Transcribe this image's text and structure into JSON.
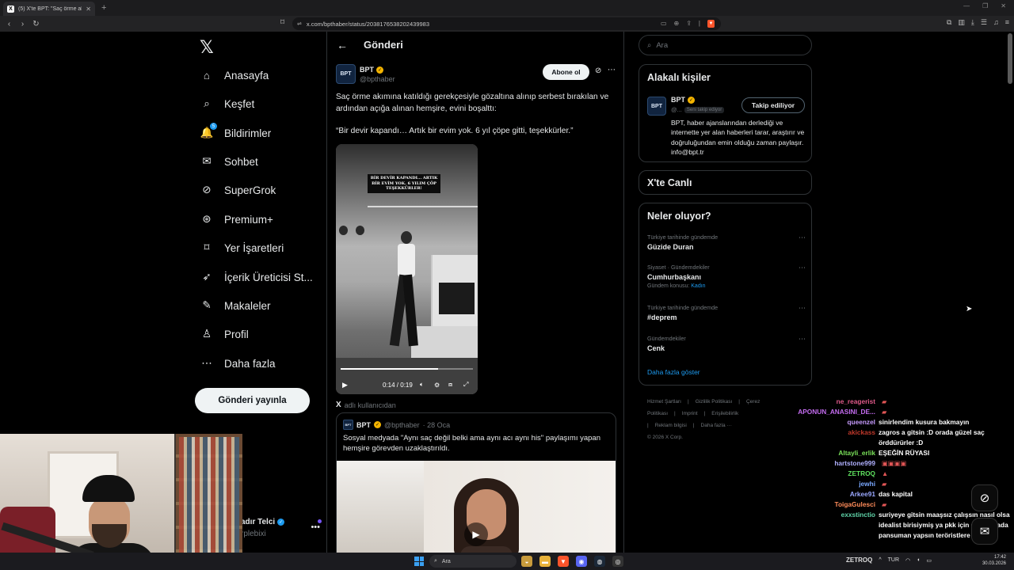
{
  "browser": {
    "tab_title": "(5) X'te BPT: \"Saç örme akımına ...",
    "tab_favicon": "X",
    "url": "x.com/bpthaber/status/2038176538202439983",
    "accent": "#1d9bf0"
  },
  "nav": {
    "logo": "𝕏",
    "items": [
      {
        "label": "Anasayfa",
        "icon": "home-icon",
        "glyph": "⌂"
      },
      {
        "label": "Keşfet",
        "icon": "search-icon",
        "glyph": "⌕"
      },
      {
        "label": "Bildirimler",
        "icon": "bell-icon",
        "glyph": "🔔",
        "badge": "5"
      },
      {
        "label": "Sohbet",
        "icon": "mail-icon",
        "glyph": "✉"
      },
      {
        "label": "SuperGrok",
        "icon": "grok-icon",
        "glyph": "⊘"
      },
      {
        "label": "Premium+",
        "icon": "premium-icon",
        "glyph": "⊛"
      },
      {
        "label": "Yer İşaretleri",
        "icon": "bookmark-icon",
        "glyph": "⌑"
      },
      {
        "label": "İçerik Üreticisi St...",
        "icon": "rocket-icon",
        "glyph": "➶"
      },
      {
        "label": "Makaleler",
        "icon": "article-icon",
        "glyph": "✎"
      },
      {
        "label": "Profil",
        "icon": "profile-icon",
        "glyph": "♙"
      },
      {
        "label": "Daha fazla",
        "icon": "more-circle-icon",
        "glyph": "⋯"
      }
    ],
    "post_button": "Gönderi yayınla",
    "account": {
      "name": "adır Telci",
      "handle": "rplebixi"
    }
  },
  "main": {
    "back": "←",
    "title": "Gönderi",
    "tweet": {
      "avatar_text": "BPT",
      "name": "BPT",
      "handle": "@bpthaber",
      "subscribe": "Abone ol",
      "text": "Saç örme akımına katıldığı gerekçesiyle gözaltına alınıp serbest bırakılan ve ardından açığa alınan hemşire, evini boşalttı:",
      "quote": "“Bir devir kapandı… Artık bir evim yok. 6 yıl çöpe gitti, teşekkürler.”",
      "video": {
        "caption": "BİR DEVİR KAPANDI... ARTIK BİR EVİM YOK. 6 YILIM ÇÖP TEŞEKKÜRLER!",
        "time": "0:14 / 0:19",
        "progress": 0.737
      },
      "source_prefix": "X",
      "source": "adlı kullanıcıdan"
    },
    "quoted": {
      "avatar_text": "BPT",
      "name": "BPT",
      "handle": "@bpthaber",
      "date": "· 28 Oca",
      "text": "Sosyal medyada \"Aynı saç değil belki ama aynı acı aynı his\" paylaşımı yapan hemşire görevden uzaklaştırıldı."
    }
  },
  "right": {
    "search_placeholder": "Ara",
    "related": {
      "title": "Alakalı kişiler",
      "name": "BPT",
      "handle": "@...",
      "follows_you": "Seni takip ediyor",
      "follow_btn": "Takip ediliyor",
      "bio": "BPT, haber ajanslarından derlediği ve internette yer alan haberleri tarar, araştırır ve doğruluğundan emin olduğu zaman paylaşır. info@bpt.tr"
    },
    "live": {
      "title": "X'te Canlı"
    },
    "trends": {
      "title": "Neler oluyor?",
      "items": [
        {
          "context": "Türkiye tarihinde gündemde",
          "name": "Güzide Duran",
          "sub": ""
        },
        {
          "context": "Siyaset · Gündemdekiler",
          "name": "Cumhurbaşkanı",
          "sub": "Gündem konusu:",
          "sub_link": "Kadın"
        },
        {
          "context": "Türkiye tarihinde gündemde",
          "name": "#deprem",
          "sub": ""
        },
        {
          "context": "Gündemdekiler",
          "name": "Cenk",
          "sub": ""
        }
      ],
      "show_more": "Daha fazla göster"
    },
    "footer": [
      "Hizmet Şartları",
      "|",
      "Gizlilik Politikası",
      "|",
      "Çerez Politikası",
      "|",
      "Imprint",
      "|",
      "Erişilebilirlik",
      "|",
      "Reklam bilgisi",
      "|",
      "Daha fazla ···",
      "© 2026 X Corp."
    ]
  },
  "chat": [
    {
      "user": "ne_reagerist",
      "color": "#e05a8a",
      "msg": "",
      "emote": "▰"
    },
    {
      "user": "APONUN_ANASINI_DE...",
      "color": "#c46cf0",
      "msg": "",
      "emote": "▰"
    },
    {
      "user": "queenzel",
      "color": "#c79cff",
      "msg": "sinirlendim kusura bakmayın"
    },
    {
      "user": "akickass",
      "color": "#c0392b",
      "msg": "zagros a gitsin :D orada güzel saç örddürürler :D"
    },
    {
      "user": "Altayli_erlik",
      "color": "#7be35a",
      "msg": "EŞEĞİN RÜYASI"
    },
    {
      "user": "hartstone999",
      "color": "#b0b0ff",
      "msg": "",
      "emote": "▣▣▣▣"
    },
    {
      "user": "ZETROQ",
      "color": "#5fe05f",
      "msg": "",
      "emote": "▲"
    },
    {
      "user": "jewhi",
      "color": "#7aa8ff",
      "msg": "",
      "emote": "▰"
    },
    {
      "user": "Arkee91",
      "color": "#9aa8ff",
      "msg": "das kapital"
    },
    {
      "user": "ToigaGulesci",
      "color": "#ff8c5a",
      "msg": "",
      "emote": "▰"
    },
    {
      "user": "exxstinctio",
      "color": "#5fd3a8",
      "msg": "suriyeye gitsin maaşsız çalışsın nasıl olsa idealist birisiymiş ya pkk için gitsin orada pansuman yapsın teröristlere"
    }
  ],
  "taskbar": {
    "search": "Ara",
    "tray_user": "ZETROQ",
    "lang": "TUR",
    "time": "17:42",
    "date": "30.03.2026"
  }
}
